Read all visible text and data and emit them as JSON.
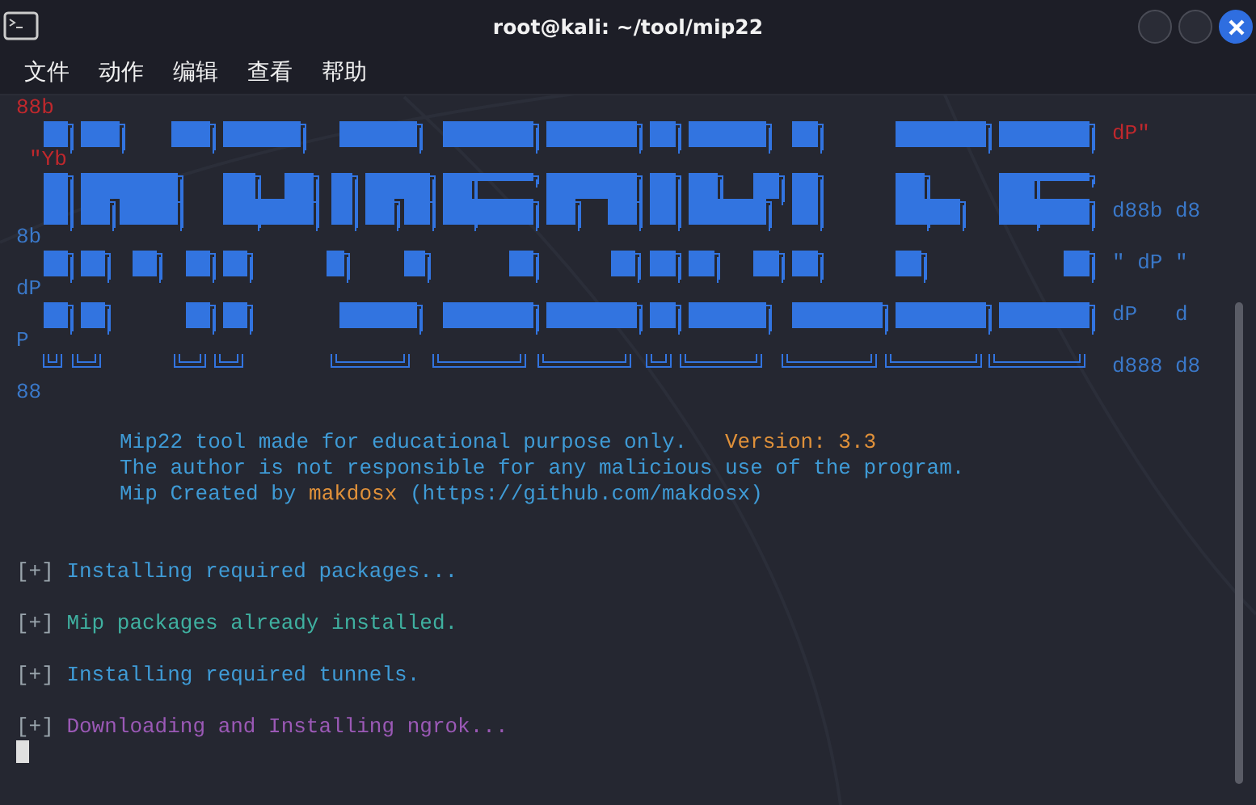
{
  "window": {
    "title": "root@kali: ~/tool/mip22"
  },
  "menu": [
    "文件",
    "动作",
    "编辑",
    "查看",
    "帮助"
  ],
  "banner_left": [
    {
      "text": "88b",
      "color": "#c0282d"
    },
    {
      "text": "\"Yb",
      "color": "#c0282d"
    },
    {
      "text": "8b",
      "color": "#3a78c9"
    },
    {
      "text": "dP",
      "color": "#3a78c9"
    },
    {
      "text": "P",
      "color": "#3a78c9"
    },
    {
      "text": "88",
      "color": "#3a78c9"
    }
  ],
  "banner_right": [
    {
      "text": "dP\"",
      "color": "#c0282d"
    },
    {
      "text": "d88b d8",
      "color": "#3a78c9"
    },
    {
      "text": "\" dP \"",
      "color": "#3a78c9"
    },
    {
      "text": "dP   d",
      "color": "#3a78c9"
    },
    {
      "text": "d888 d8",
      "color": "#3a78c9"
    }
  ],
  "info": [
    [
      {
        "text": "Mip22 tool made for educational purpose only.   ",
        "kind": "plain"
      },
      {
        "text": "Version: 3.3",
        "kind": "accent"
      }
    ],
    [
      {
        "text": "The author is not responsible for any malicious use of the program.",
        "kind": "plain"
      }
    ],
    [
      {
        "text": "Mip Created by ",
        "kind": "plain"
      },
      {
        "text": "makdosx",
        "kind": "accent"
      },
      {
        "text": " (https://github.com/makdosx)",
        "kind": "plain"
      }
    ]
  ],
  "log": [
    {
      "mark": "[+]",
      "text": "Installing required packages...",
      "color": "#3f9bd6"
    },
    {
      "mark": "[+]",
      "text": "Mip packages already installed.",
      "color": "#3fb0a0"
    },
    {
      "mark": "[+]",
      "text": "Installing required tunnels.",
      "color": "#3f9bd6"
    },
    {
      "mark": "[+]",
      "text": "Downloading and Installing ngrok...",
      "color": "#9b59b6"
    }
  ]
}
